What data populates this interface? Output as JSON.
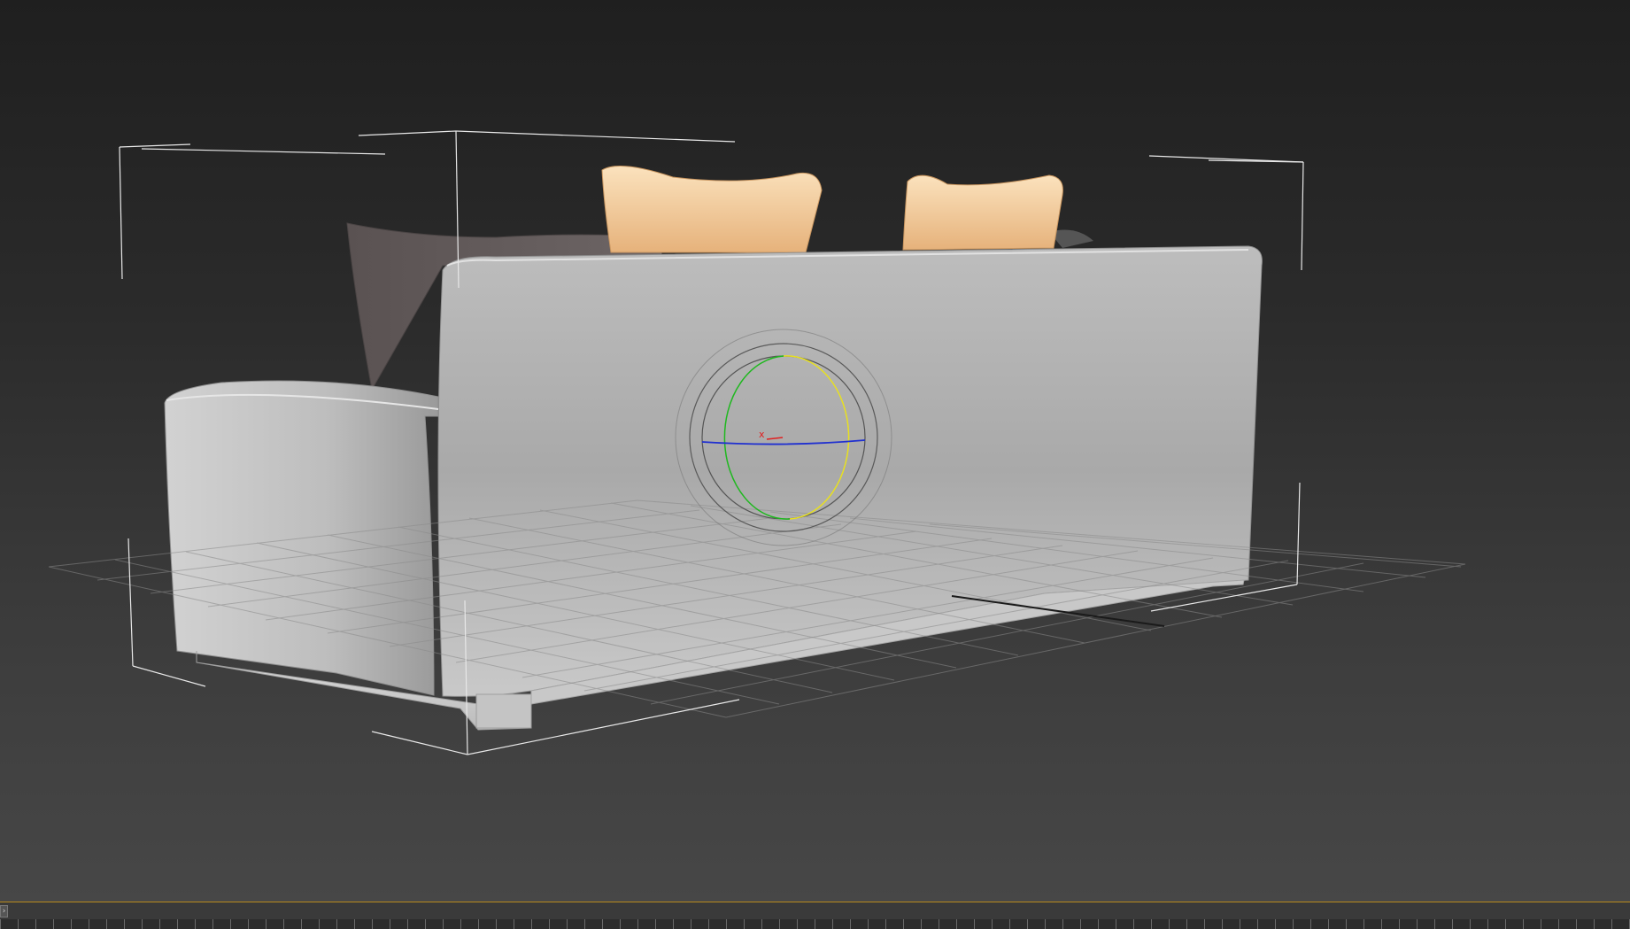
{
  "app": {
    "viewport_label": "",
    "timeline_handle_glyph": "›"
  },
  "scene": {
    "object": "sofa",
    "gizmo": "rotate",
    "gizmo_axis_marker": "x"
  },
  "colors": {
    "viewport_top": "#1f1f1f",
    "viewport_bottom": "#474747",
    "timeline_accent": "#b88a1c",
    "gizmo_x": "#e02020",
    "gizmo_y": "#1fb81f",
    "gizmo_z": "#2030d0",
    "gizmo_view": "#e8e020"
  }
}
